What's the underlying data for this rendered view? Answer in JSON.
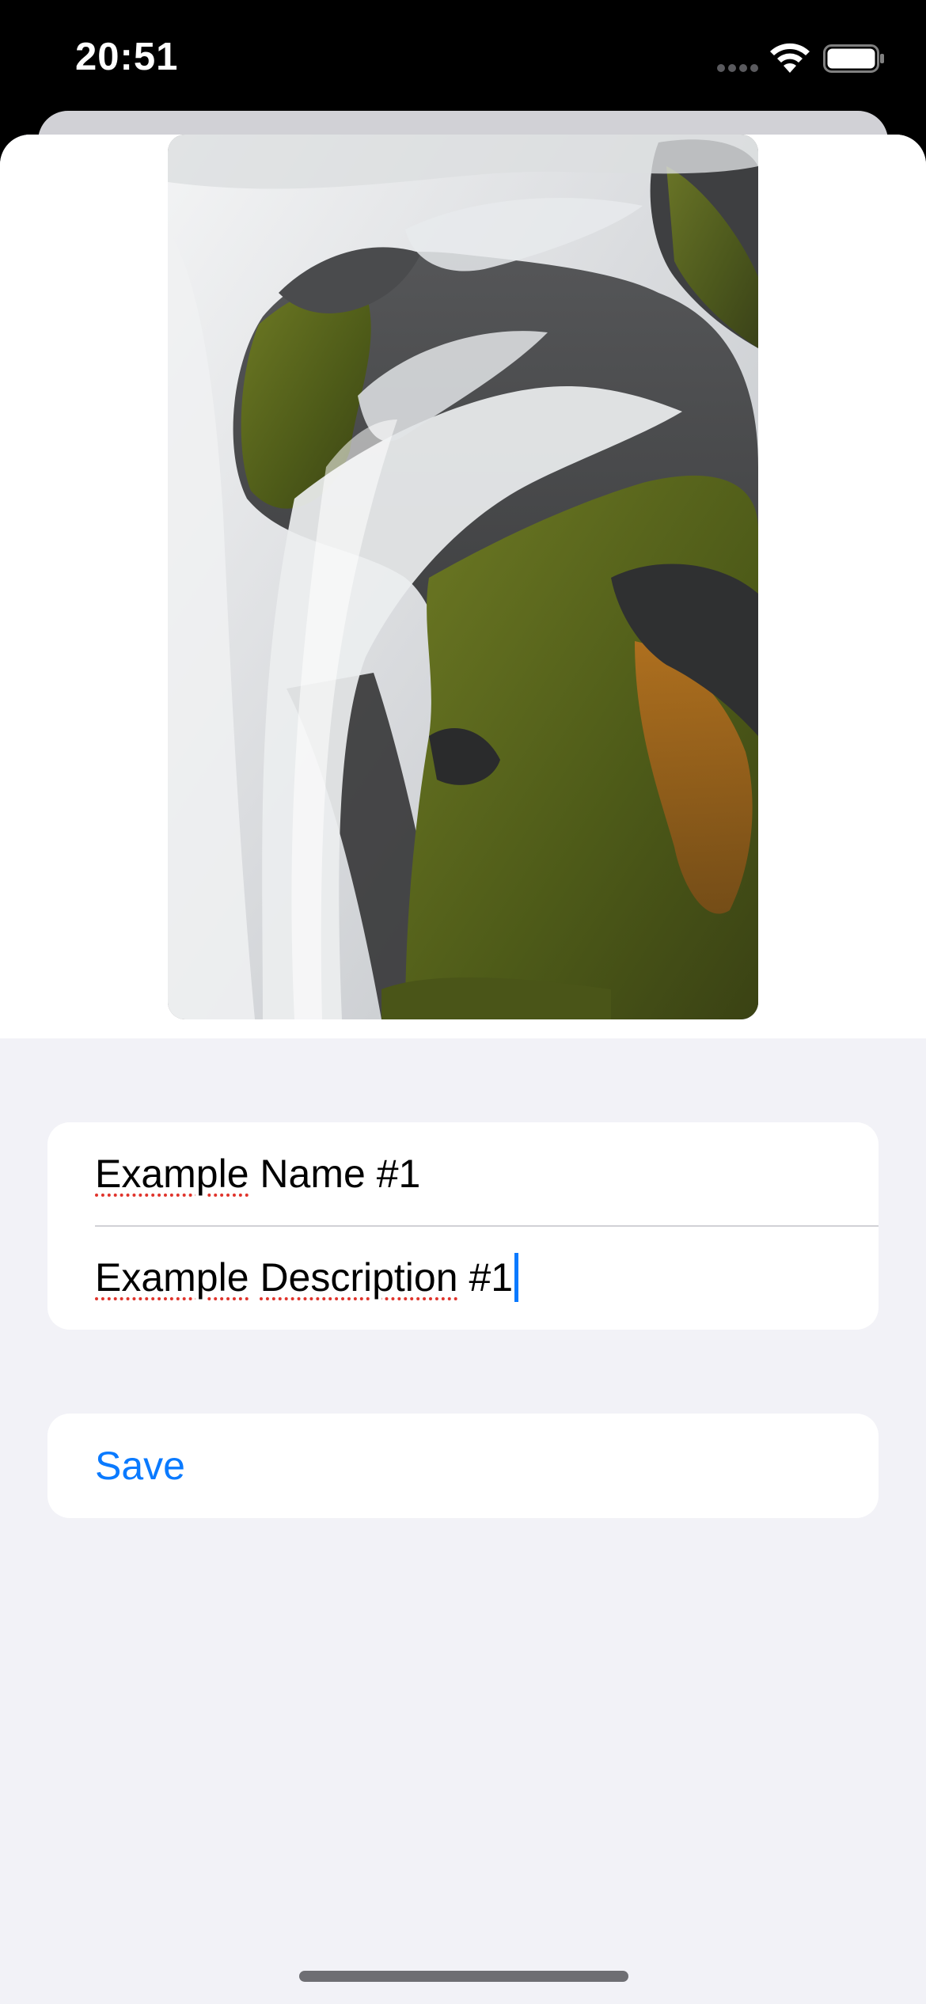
{
  "status_bar": {
    "time": "20:51",
    "icons": [
      "signal-dots-icon",
      "wifi-icon",
      "battery-icon"
    ]
  },
  "photo": {
    "subject": "waterfall-over-mossy-rocks",
    "colors": {
      "water": "#e6e8ea",
      "rock": "#3c3d3f",
      "moss": "#5f6a1e",
      "rust": "#a9621b"
    }
  },
  "form": {
    "name_value": "Example Name #1",
    "name_spell_word": "Example",
    "name_rest": " Name #1",
    "description_value": "Example Description #1",
    "description_spell_word_1": "Example",
    "description_space": " ",
    "description_spell_word_2": "Description",
    "description_rest": " #1"
  },
  "actions": {
    "save_label": "Save"
  },
  "colors": {
    "accent": "#0a7aff",
    "sheet_background": "#f2f2f7",
    "group_background": "#ffffff",
    "spellcheck": "#e0342c"
  }
}
